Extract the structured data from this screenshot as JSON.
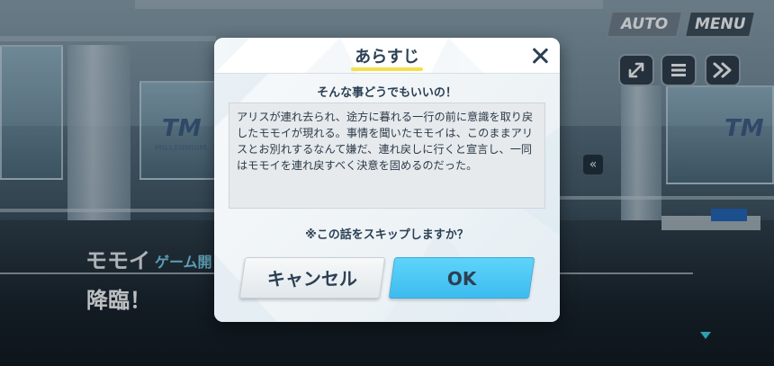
{
  "hud": {
    "auto_label": "AUTO",
    "menu_label": "MENU"
  },
  "scene": {
    "logo_text": "MILLENNIUM"
  },
  "dialogue": {
    "speaker": "モモイ",
    "speaker_affiliation": "ゲーム開",
    "text": "降臨！"
  },
  "modal": {
    "title": "あらすじ",
    "episode_title": "そんな事どうでもいいの！",
    "synopsis": "アリスが連れ去られ、途方に暮れる一行の前に意識を取り戻\nしたモモイが現れる。事情を聞いたモモイは、このままアリ\nスとお別れするなんて嫌だ、連れ戻しに行くと宣言し、一同\nはモモイを連れ戻すべく決意を固めるのだった。",
    "skip_question": "※この話をスキップしますか？",
    "cancel_label": "キャンセル",
    "ok_label": "OK"
  },
  "colors": {
    "accent_ok": "#45c3f3",
    "title_underline": "#f5e04b",
    "dialogue_accent": "#7ad0ee"
  }
}
